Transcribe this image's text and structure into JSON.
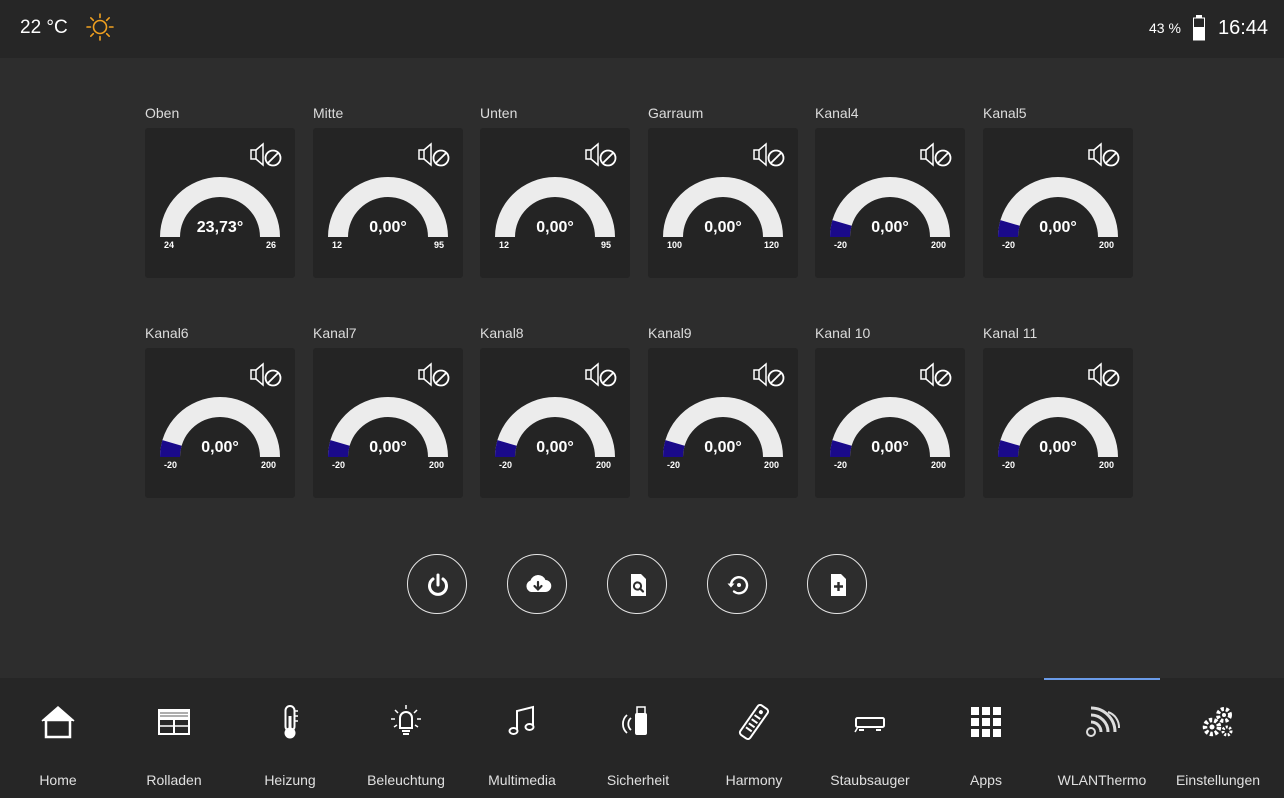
{
  "header": {
    "temperature": "22 °C",
    "weather_icon": "sun-icon",
    "battery": "43 %",
    "time": "16:44"
  },
  "gauges": [
    {
      "label": "Oben",
      "value": "23,73°",
      "min": "24",
      "max": "26",
      "fill": 0
    },
    {
      "label": "Mitte",
      "value": "0,00°",
      "min": "12",
      "max": "95",
      "fill": 0
    },
    {
      "label": "Unten",
      "value": "0,00°",
      "min": "12",
      "max": "95",
      "fill": 0
    },
    {
      "label": "Garraum",
      "value": "0,00°",
      "min": "100",
      "max": "120",
      "fill": 0
    },
    {
      "label": "Kanal4",
      "value": "0,00°",
      "min": "-20",
      "max": "200",
      "fill": 0.0909
    },
    {
      "label": "Kanal5",
      "value": "0,00°",
      "min": "-20",
      "max": "200",
      "fill": 0.0909
    },
    {
      "label": "Kanal6",
      "value": "0,00°",
      "min": "-20",
      "max": "200",
      "fill": 0.0909
    },
    {
      "label": "Kanal7",
      "value": "0,00°",
      "min": "-20",
      "max": "200",
      "fill": 0.0909
    },
    {
      "label": "Kanal8",
      "value": "0,00°",
      "min": "-20",
      "max": "200",
      "fill": 0.0909
    },
    {
      "label": "Kanal9",
      "value": "0,00°",
      "min": "-20",
      "max": "200",
      "fill": 0.0909
    },
    {
      "label": "Kanal 10",
      "value": "0,00°",
      "min": "-20",
      "max": "200",
      "fill": 0.0909
    },
    {
      "label": "Kanal 11",
      "value": "0,00°",
      "min": "-20",
      "max": "200",
      "fill": 0.0909
    }
  ],
  "controls": [
    {
      "name": "power-icon"
    },
    {
      "name": "cloud-download-icon"
    },
    {
      "name": "file-search-icon"
    },
    {
      "name": "restore-icon"
    },
    {
      "name": "file-add-icon"
    }
  ],
  "nav": [
    {
      "label": "Home",
      "icon": "home-icon"
    },
    {
      "label": "Rolladen",
      "icon": "shutter-icon"
    },
    {
      "label": "Heizung",
      "icon": "thermometer-icon"
    },
    {
      "label": "Beleuchtung",
      "icon": "lightbulb-icon"
    },
    {
      "label": "Multimedia",
      "icon": "music-note-icon"
    },
    {
      "label": "Sicherheit",
      "icon": "alarm-icon"
    },
    {
      "label": "Harmony",
      "icon": "remote-control-icon"
    },
    {
      "label": "Staubsauger",
      "icon": "vacuum-robot-icon"
    },
    {
      "label": "Apps",
      "icon": "apps-grid-icon"
    },
    {
      "label": "WLANThermo",
      "icon": "wlanthermo-icon",
      "active": true
    },
    {
      "label": "Einstellungen",
      "icon": "gears-icon"
    }
  ],
  "colors": {
    "gauge_track": "#ececec",
    "gauge_fill": "#1a0a8a",
    "active_tab": "#6a9be8",
    "sun": "#f0a020"
  }
}
